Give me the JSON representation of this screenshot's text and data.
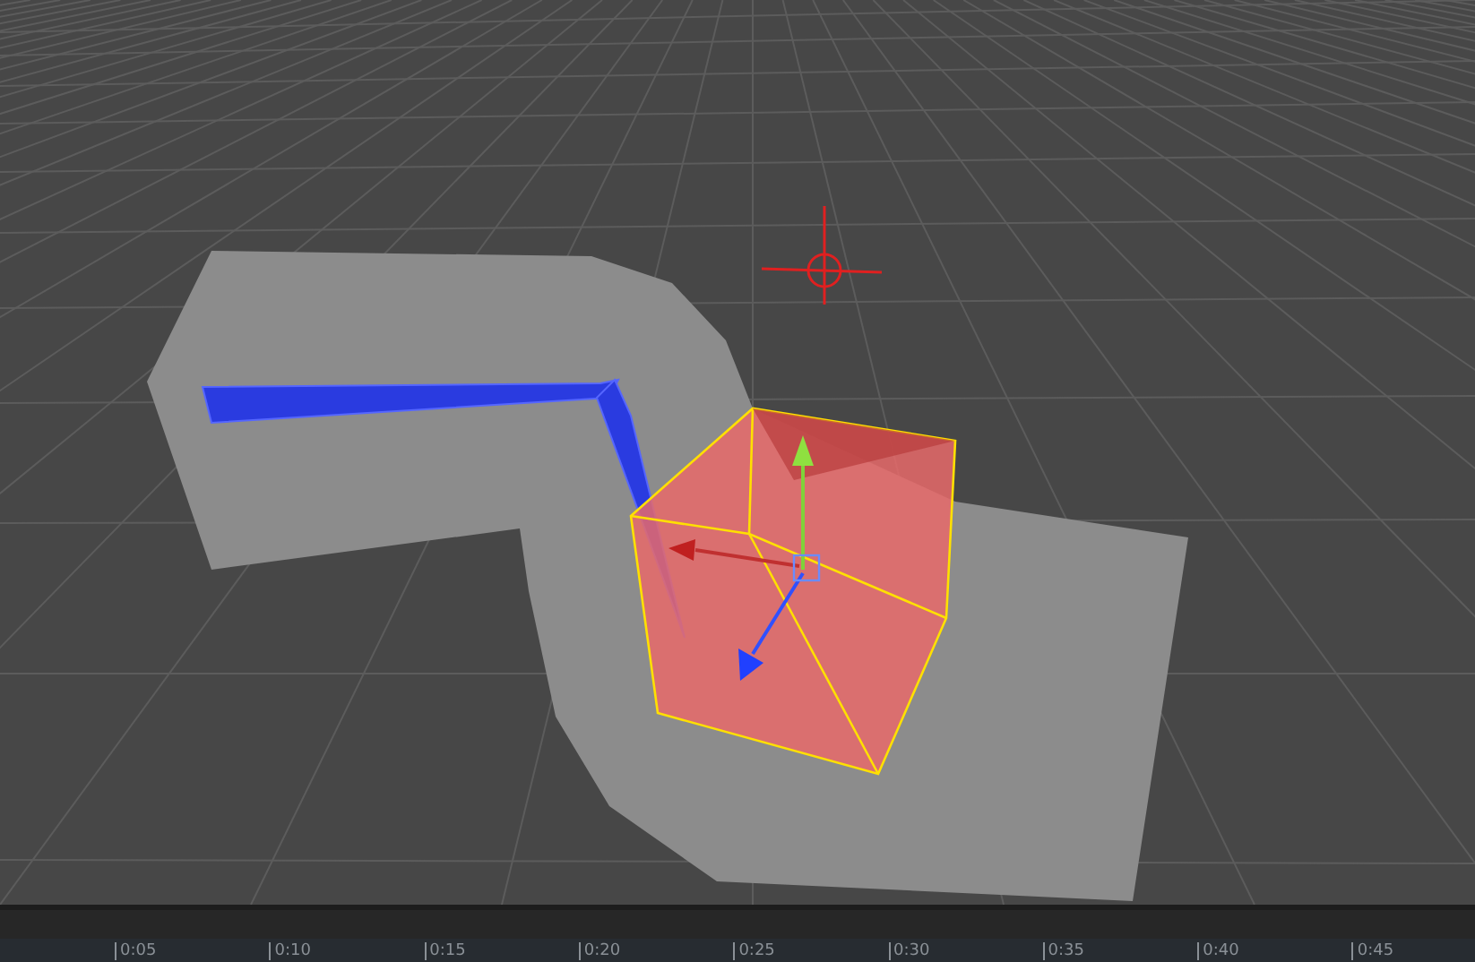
{
  "timeline": {
    "ticks": [
      "0:05",
      "0:10",
      "0:15",
      "0:20",
      "0:25",
      "0:30",
      "0:35",
      "0:40",
      "0:45"
    ]
  }
}
